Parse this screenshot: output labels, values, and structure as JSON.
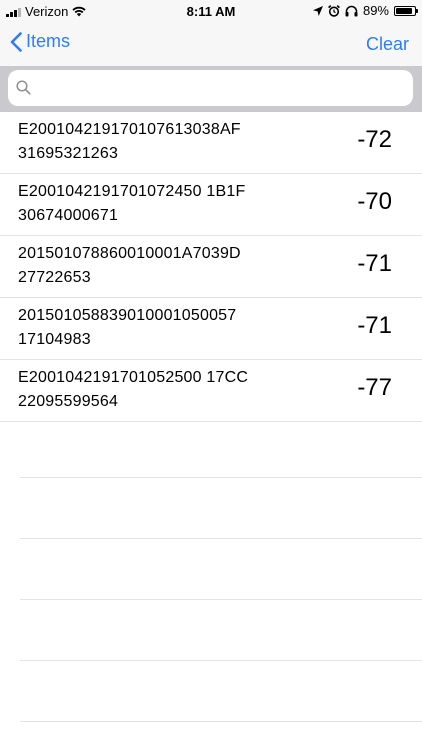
{
  "status": {
    "carrier": "Verizon",
    "time": "8:11 AM",
    "battery": "89%",
    "battery_level": 0.89
  },
  "nav": {
    "back_label": "Items",
    "clear_label": "Clear"
  },
  "search": {
    "placeholder": "",
    "value": ""
  },
  "items": [
    {
      "line1": "E200104219170107613038AF",
      "line2": "31695321263",
      "rssi": "-72"
    },
    {
      "line1": "E2001042191701072450 1B1F",
      "line2": "30674000671",
      "rssi": "-70"
    },
    {
      "line1": "201501078860010001A7039D",
      "line2": "27722653",
      "rssi": "-71"
    },
    {
      "line1": "201501058839010001050057",
      "line2": "17104983",
      "rssi": "-71"
    },
    {
      "line1": "E2001042191701052500 17CC",
      "line2": "22095599564",
      "rssi": "-77"
    }
  ],
  "icons": {
    "back": "chevron-left-icon",
    "search": "magnifier-icon",
    "wifi": "wifi-icon",
    "location": "location-arrow-icon",
    "alarm": "alarm-icon",
    "headphones": "headphones-icon",
    "battery": "battery-icon"
  },
  "colors": {
    "accent": "#2f7cf6",
    "bar_bg": "#f7f7f7",
    "search_bg": "#c9c9ce",
    "separator": "#e3e3e3"
  }
}
